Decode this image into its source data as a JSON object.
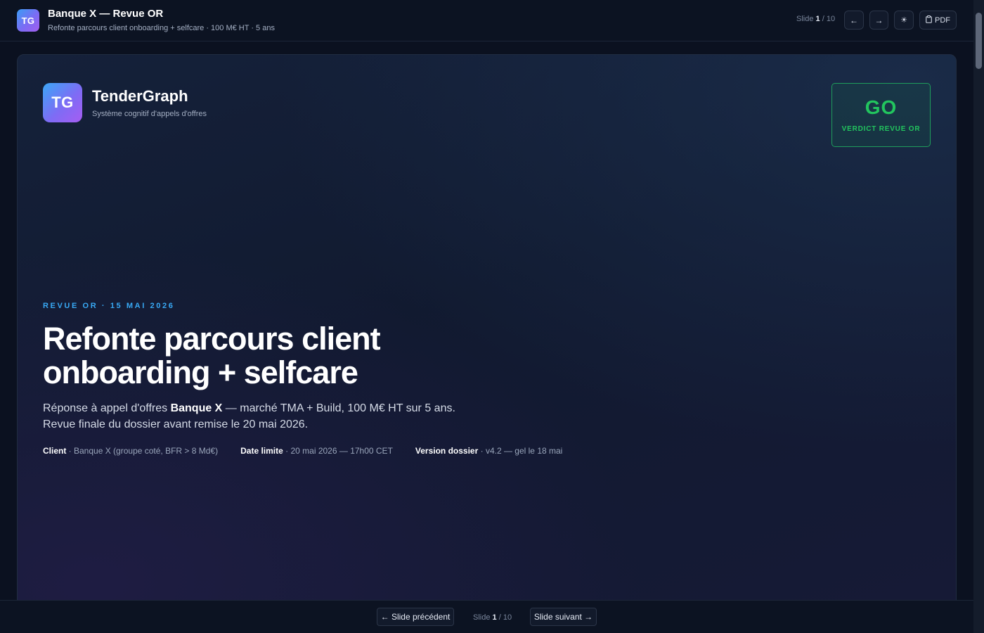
{
  "topbar": {
    "logo_text": "TG",
    "title": "Banque X — Revue OR",
    "subtitle": "Refonte parcours client onboarding + selfcare · 100 M€ HT · 5 ans",
    "slide_label": "Slide",
    "slide_current": "1",
    "slide_total": "/ 10",
    "prev_label": "←",
    "next_label": "→",
    "theme_label": "☀",
    "pdf_label": "PDF",
    "pdf_icon": "clipboard-icon"
  },
  "slide": {
    "brand": {
      "logo_text": "TG",
      "name": "TenderGraph",
      "tagline": "Système cognitif d'appels d'offres"
    },
    "verdict": {
      "value": "GO",
      "label": "VERDICT REVUE OR",
      "color": "#22c55e"
    },
    "eyebrow": "REVUE OR · 15 MAI 2026",
    "headline": "Refonte parcours client onboarding + selfcare",
    "lead": {
      "part1": "Réponse à appel d'offres ",
      "client_bold": "Banque X",
      "part2": " — marché TMA + Build, 100 M€ HT sur 5 ans.",
      "line2": "Revue finale du dossier avant remise le 20 mai 2026."
    },
    "meta": [
      {
        "label": "Client",
        "value": " · Banque X (groupe coté, BFR > 8 Md€)"
      },
      {
        "label": "Date limite",
        "value": " · 20 mai 2026 — 17h00 CET"
      },
      {
        "label": "Version dossier",
        "value": " · v4.2 — gel le 18 mai"
      }
    ]
  },
  "bottombar": {
    "prev_label": "← Slide précédent",
    "next_label": "Slide suivant →",
    "slide_label": "Slide",
    "slide_current": "1",
    "slide_total": "/ 10"
  },
  "colors": {
    "accent": "#38a9f5",
    "go": "#22c55e",
    "background": "#0b1120"
  }
}
